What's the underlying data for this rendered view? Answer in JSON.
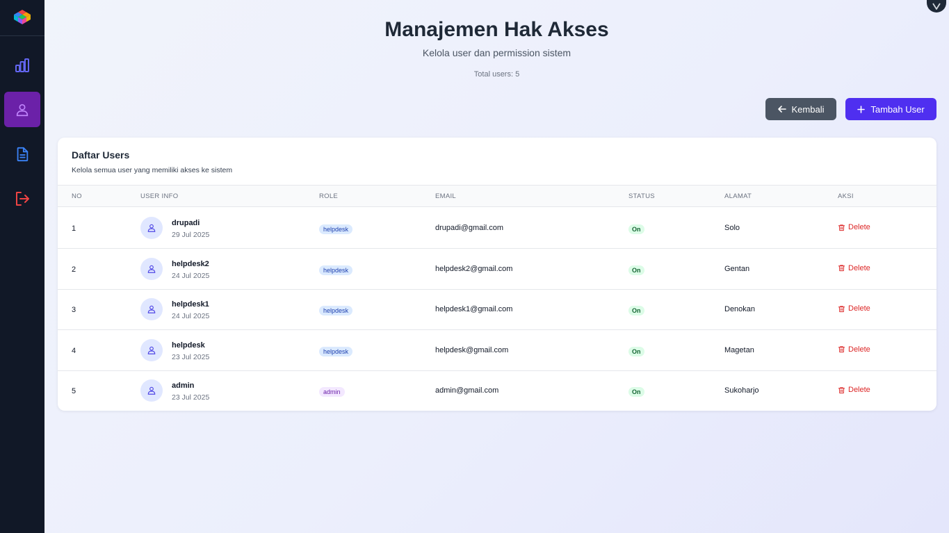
{
  "sidebar": {
    "items": [
      {
        "icon": "bar-chart-icon"
      },
      {
        "icon": "user-icon",
        "active": true
      },
      {
        "icon": "document-icon"
      },
      {
        "icon": "logout-icon"
      }
    ]
  },
  "header": {
    "title": "Manajemen Hak Akses",
    "subtitle": "Kelola user dan permission sistem",
    "total": "Total users: 5"
  },
  "actions": {
    "back_label": "Kembali",
    "add_label": "Tambah User"
  },
  "table": {
    "title": "Daftar Users",
    "subtitle": "Kelola semua user yang memiliki akses ke sistem",
    "columns": [
      "NO",
      "USER INFO",
      "ROLE",
      "EMAIL",
      "STATUS",
      "ALAMAT",
      "AKSI"
    ],
    "delete_label": "Delete",
    "rows": [
      {
        "no": "1",
        "name": "drupadi",
        "date": "29 Jul 2025",
        "role": "helpdesk",
        "email": "drupadi@gmail.com",
        "status": "On",
        "alamat": "Solo"
      },
      {
        "no": "2",
        "name": "helpdesk2",
        "date": "24 Jul 2025",
        "role": "helpdesk",
        "email": "helpdesk2@gmail.com",
        "status": "On",
        "alamat": "Gentan"
      },
      {
        "no": "3",
        "name": "helpdesk1",
        "date": "24 Jul 2025",
        "role": "helpdesk",
        "email": "helpdesk1@gmail.com",
        "status": "On",
        "alamat": "Denokan"
      },
      {
        "no": "4",
        "name": "helpdesk",
        "date": "23 Jul 2025",
        "role": "helpdesk",
        "email": "helpdesk@gmail.com",
        "status": "On",
        "alamat": "Magetan"
      },
      {
        "no": "5",
        "name": "admin",
        "date": "23 Jul 2025",
        "role": "admin",
        "email": "admin@gmail.com",
        "status": "On",
        "alamat": "Sukoharjo"
      }
    ]
  },
  "colors": {
    "sidebar_bg": "#111827",
    "active_nav": "#6b21a8",
    "primary": "#4f2ff0",
    "secondary": "#4b5563",
    "danger": "#dc2626"
  }
}
